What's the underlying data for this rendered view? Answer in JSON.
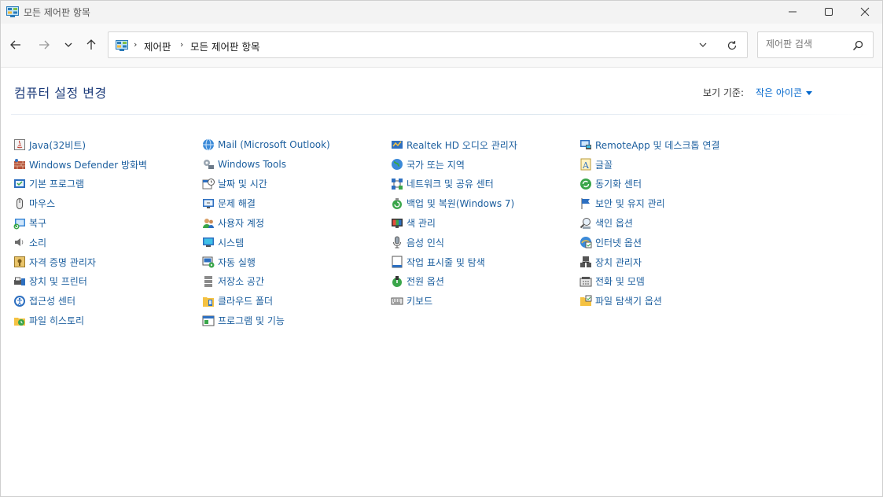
{
  "window": {
    "title": "모든 제어판 항목"
  },
  "breadcrumb": [
    "제어판",
    "모든 제어판 항목"
  ],
  "search": {
    "placeholder": "제어판 검색"
  },
  "page": {
    "heading": "컴퓨터 설정 변경",
    "view_by_label": "보기 기준:",
    "view_by_value": "작은 아이콘"
  },
  "columns": [
    [
      {
        "label": "Java(32비트)",
        "icon": "java-icon"
      },
      {
        "label": "Windows Defender 방화벽",
        "icon": "firewall-icon"
      },
      {
        "label": "기본 프로그램",
        "icon": "default-programs-icon"
      },
      {
        "label": "마우스",
        "icon": "mouse-icon"
      },
      {
        "label": "복구",
        "icon": "recovery-icon"
      },
      {
        "label": "소리",
        "icon": "sound-icon"
      },
      {
        "label": "자격 증명 관리자",
        "icon": "credential-manager-icon"
      },
      {
        "label": "장치 및 프린터",
        "icon": "devices-printers-icon"
      },
      {
        "label": "접근성 센터",
        "icon": "ease-of-access-icon"
      },
      {
        "label": "파일 히스토리",
        "icon": "file-history-icon"
      }
    ],
    [
      {
        "label": "Mail (Microsoft Outlook)",
        "icon": "mail-icon"
      },
      {
        "label": "Windows Tools",
        "icon": "windows-tools-icon"
      },
      {
        "label": "날짜 및 시간",
        "icon": "date-time-icon"
      },
      {
        "label": "문제 해결",
        "icon": "troubleshooting-icon"
      },
      {
        "label": "사용자 계정",
        "icon": "user-accounts-icon"
      },
      {
        "label": "시스템",
        "icon": "system-icon"
      },
      {
        "label": "자동 실행",
        "icon": "autoplay-icon"
      },
      {
        "label": "저장소 공간",
        "icon": "storage-spaces-icon"
      },
      {
        "label": "클라우드 폴더",
        "icon": "cloud-folder-icon"
      },
      {
        "label": "프로그램 및 기능",
        "icon": "programs-features-icon"
      }
    ],
    [
      {
        "label": "Realtek HD 오디오 관리자",
        "icon": "realtek-audio-icon"
      },
      {
        "label": "국가 또는 지역",
        "icon": "region-icon"
      },
      {
        "label": "네트워크 및 공유 센터",
        "icon": "network-sharing-icon"
      },
      {
        "label": "백업 및 복원(Windows 7)",
        "icon": "backup-restore-icon"
      },
      {
        "label": "색 관리",
        "icon": "color-management-icon"
      },
      {
        "label": "음성 인식",
        "icon": "speech-recognition-icon"
      },
      {
        "label": "작업 표시줄 및 탐색",
        "icon": "taskbar-icon"
      },
      {
        "label": "전원 옵션",
        "icon": "power-options-icon"
      },
      {
        "label": "키보드",
        "icon": "keyboard-icon"
      }
    ],
    [
      {
        "label": "RemoteApp 및 데스크톱 연결",
        "icon": "remoteapp-icon"
      },
      {
        "label": "글꼴",
        "icon": "fonts-icon"
      },
      {
        "label": "동기화 센터",
        "icon": "sync-center-icon"
      },
      {
        "label": "보안 및 유지 관리",
        "icon": "security-maintenance-icon"
      },
      {
        "label": "색인 옵션",
        "icon": "indexing-options-icon"
      },
      {
        "label": "인터넷 옵션",
        "icon": "internet-options-icon"
      },
      {
        "label": "장치 관리자",
        "icon": "device-manager-icon"
      },
      {
        "label": "전화 및 모뎀",
        "icon": "phone-modem-icon"
      },
      {
        "label": "파일 탐색기 옵션",
        "icon": "file-explorer-options-icon"
      }
    ]
  ],
  "colors": {
    "link": "#1b5e9e",
    "heading": "#1e3d7b",
    "accent": "#0066cc"
  }
}
